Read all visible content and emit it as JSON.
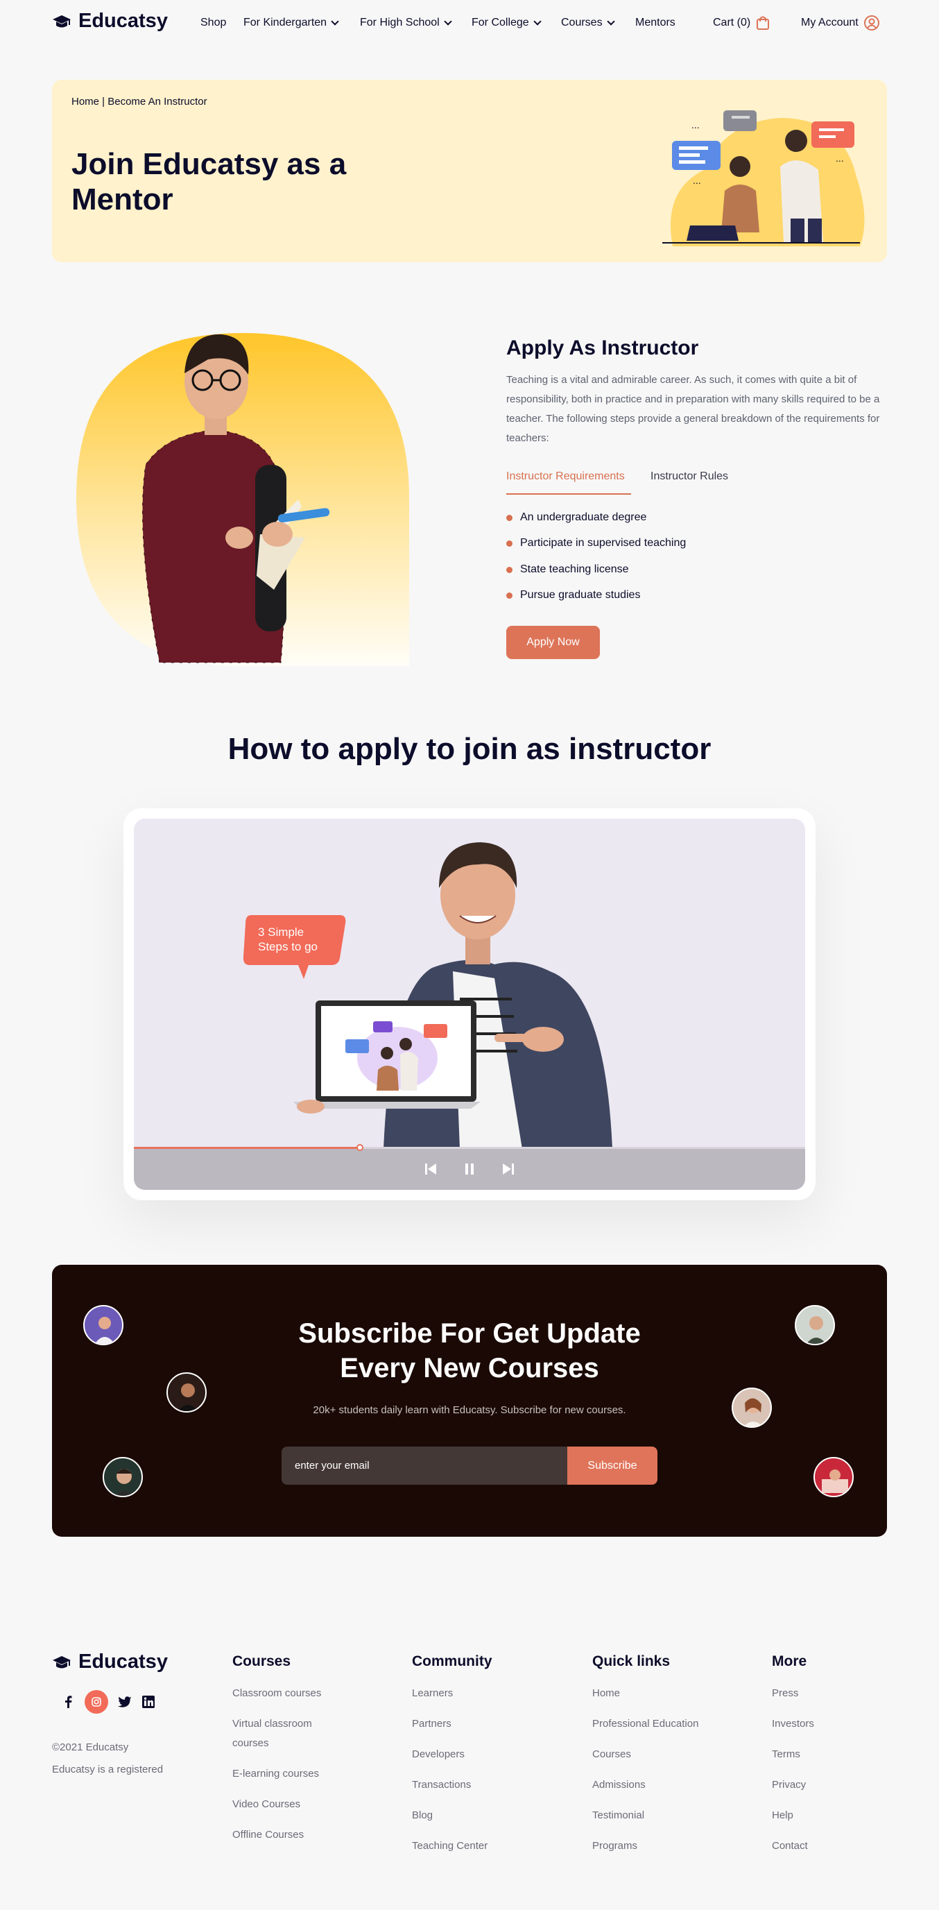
{
  "brand": {
    "name": "Educatsy",
    "accent": "#dd7458",
    "dark": "#0c0c2b"
  },
  "nav": {
    "items": [
      {
        "label": "Shop"
      },
      {
        "label": "For Kindergarten"
      },
      {
        "label": "For High School"
      },
      {
        "label": "For College"
      },
      {
        "label": "Courses"
      },
      {
        "label": "Mentors"
      }
    ],
    "cart": "Cart (0)",
    "account": "My Account"
  },
  "hero": {
    "breadcrumb": "Home | Become An Instructor",
    "title": "Join Educatsy as a Mentor"
  },
  "apply": {
    "title": "Apply As Instructor",
    "description": "Teaching is a vital and admirable career. As such, it comes with quite a bit of responsibility, both in practice and in preparation with many skills required to be a teacher. The following steps provide a general breakdown of the requirements for teachers:",
    "tabs": [
      {
        "label": "Instructor Requirements",
        "active": true
      },
      {
        "label": "Instructor Rules",
        "active": false
      }
    ],
    "requirements": [
      "An undergraduate degree",
      "Participate in supervised teaching",
      "State teaching license",
      "Pursue graduate studies"
    ],
    "button": "Apply Now"
  },
  "how_to": {
    "title": "How to apply to join as instructor",
    "bubble": "3 Simple Steps to go",
    "progress": 0.337
  },
  "subscribe": {
    "title": "Subscribe For Get Update Every New Courses",
    "subtitle": "20k+ students daily learn with Educatsy. Subscribe for new courses.",
    "placeholder": "enter your email",
    "button": "Subscribe"
  },
  "footer": {
    "copyright": "©2021 Educatsy",
    "note": "Educatsy is a registered",
    "social": [
      "facebook-icon",
      "instagram-icon",
      "twitter-icon",
      "linkedin-icon"
    ],
    "columns": [
      {
        "title": "Courses",
        "links": [
          "Classroom courses",
          "Virtual classroom courses",
          "E-learning courses",
          "Video Courses",
          "Offline Courses"
        ]
      },
      {
        "title": "Community",
        "links": [
          "Learners",
          "Partners",
          "Developers",
          "Transactions",
          "Blog",
          "Teaching Center"
        ]
      },
      {
        "title": "Quick links",
        "links": [
          "Home",
          "Professional Education",
          "Courses",
          "Admissions",
          "Testimonial",
          "Programs"
        ]
      },
      {
        "title": "More",
        "links": [
          "Press",
          "Investors",
          "Terms",
          "Privacy",
          "Help",
          "Contact"
        ]
      }
    ]
  }
}
